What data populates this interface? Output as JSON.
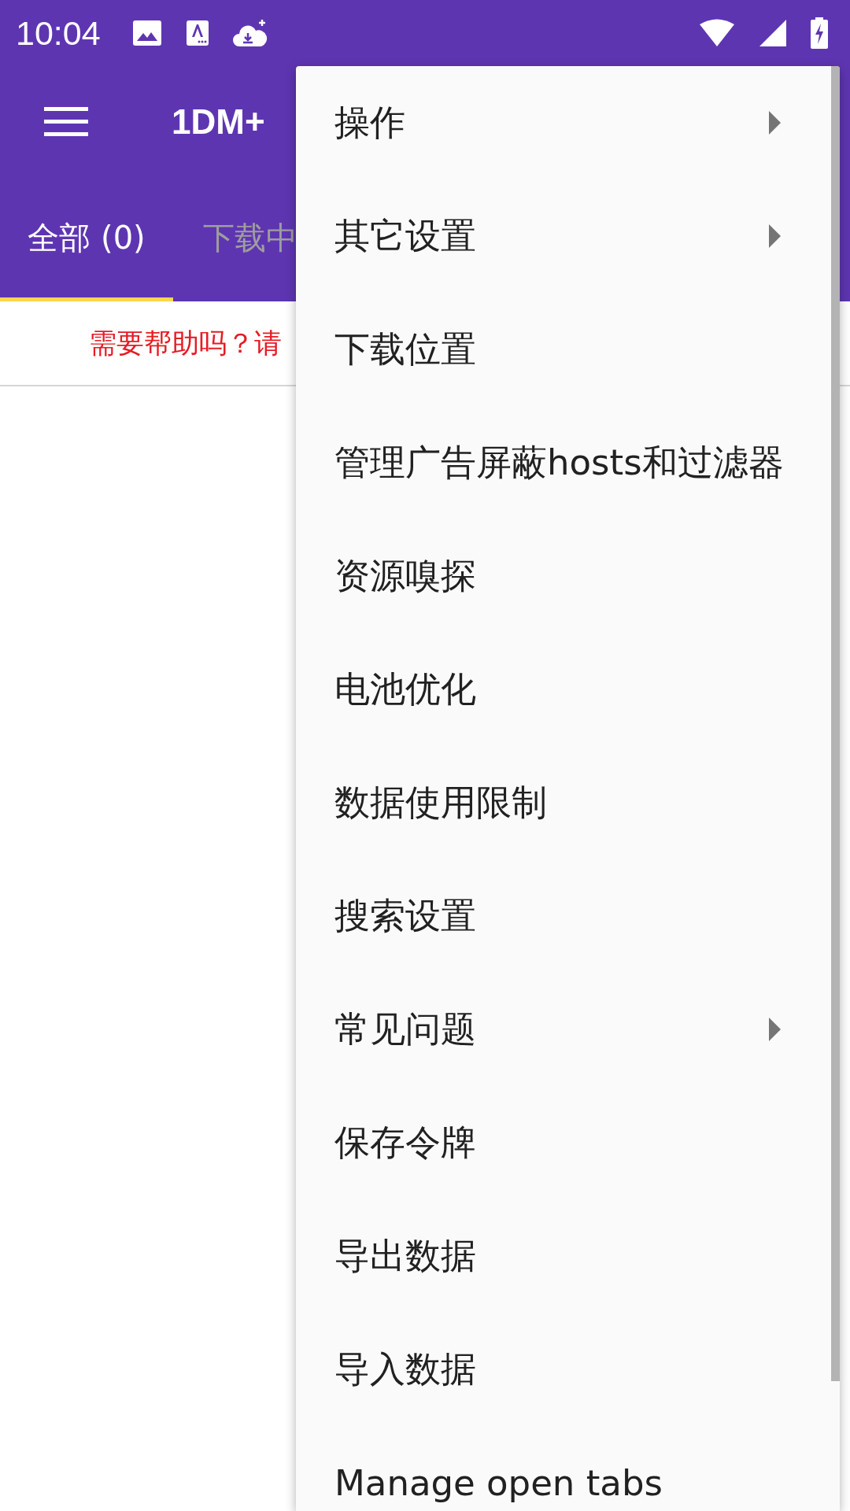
{
  "status_bar": {
    "time": "10:04"
  },
  "app_bar": {
    "title": "1DM+"
  },
  "tabs": [
    {
      "label": "全部 (0)",
      "selected": true
    },
    {
      "label": "下载中",
      "selected": false
    }
  ],
  "help_banner": {
    "text": "需要帮助吗？请"
  },
  "menu": {
    "items": [
      {
        "label": "操作",
        "has_submenu": true
      },
      {
        "label": "其它设置",
        "has_submenu": true
      },
      {
        "label": "下载位置",
        "has_submenu": false
      },
      {
        "label": "管理广告屏蔽hosts和过滤器",
        "has_submenu": false
      },
      {
        "label": "资源嗅探",
        "has_submenu": false
      },
      {
        "label": "电池优化",
        "has_submenu": false
      },
      {
        "label": "数据使用限制",
        "has_submenu": false
      },
      {
        "label": "搜索设置",
        "has_submenu": false
      },
      {
        "label": "常见问题",
        "has_submenu": true
      },
      {
        "label": "保存令牌",
        "has_submenu": false
      },
      {
        "label": "导出数据",
        "has_submenu": false
      },
      {
        "label": "导入数据",
        "has_submenu": false
      },
      {
        "label": "Manage open tabs",
        "has_submenu": false
      }
    ]
  }
}
